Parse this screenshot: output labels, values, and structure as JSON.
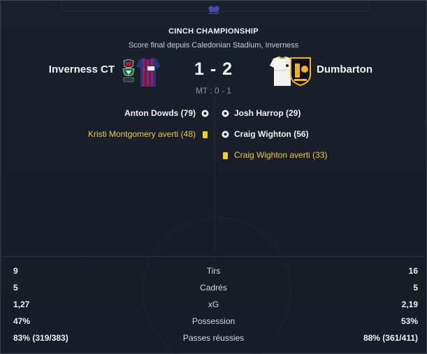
{
  "match": {
    "competition": "CINCH CHAMPIONSHIP",
    "subtitle": "Score final depuis Caledonian Stadium, Inverness",
    "home_team": "Inverness CT",
    "away_team": "Dumbarton",
    "score": "1 - 2",
    "halftime": "MT : 0 - 1"
  },
  "events": {
    "home": [
      {
        "type": "goal",
        "text": "Anton Dowds (79)",
        "icon": "football-icon"
      },
      {
        "type": "yellow-card",
        "text": "Kristi Montgomery averti (48)",
        "icon": "yellow-card-icon"
      }
    ],
    "away": [
      {
        "type": "goal",
        "text": "Josh Harrop (29)",
        "icon": "football-icon"
      },
      {
        "type": "goal",
        "text": "Craig Wighton (56)",
        "icon": "football-icon"
      },
      {
        "type": "yellow-card",
        "text": "Craig Wighton averti (33)",
        "icon": "yellow-card-icon"
      }
    ]
  },
  "stats": [
    {
      "label": "Tirs",
      "home": "9",
      "away": "16"
    },
    {
      "label": "Cadrés",
      "home": "5",
      "away": "5"
    },
    {
      "label": "xG",
      "home": "1,27",
      "away": "2,19"
    },
    {
      "label": "Possession",
      "home": "47%",
      "away": "53%"
    },
    {
      "label": "Passes réussies",
      "home": "83% (319/383)",
      "away": "88% (361/411)"
    }
  ],
  "colors": {
    "card_yellow": "#f1d21e",
    "card_text": "#e9c94a",
    "home_kit_primary": "#1d3a8a",
    "home_kit_secondary": "#c8102e",
    "away_kit_primary": "#f2f2f0",
    "away_crest": "#f0b323"
  }
}
